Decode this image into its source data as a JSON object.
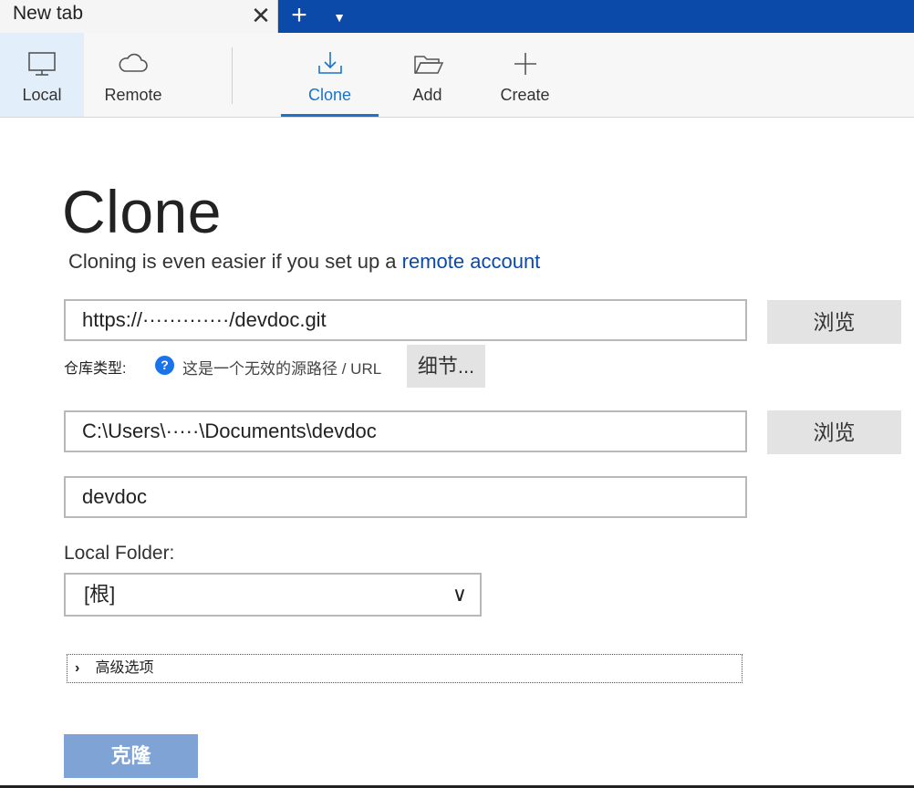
{
  "tabs": {
    "title": "New tab",
    "close_glyph": "✕",
    "add_glyph": "+",
    "dropdown_glyph": "▼"
  },
  "toolbar": {
    "local": {
      "label": "Local",
      "icon": "monitor-icon"
    },
    "remote": {
      "label": "Remote",
      "icon": "cloud-icon"
    },
    "clone": {
      "label": "Clone",
      "icon": "download-icon"
    },
    "add": {
      "label": "Add",
      "icon": "folder-open-icon"
    },
    "create": {
      "label": "Create",
      "icon": "plus-icon"
    }
  },
  "main": {
    "title": "Clone",
    "subtitle_prefix": "Cloning is even easier if you set up a ",
    "subtitle_link": "remote account",
    "source_url": "https://·············/devdoc.git",
    "browse_label": "浏览",
    "repo_type_label": "仓库类型:",
    "help_glyph": "?",
    "repo_status": "这是一个无效的源路径 / URL",
    "details_label": "细节...",
    "dest_path": "C:\\Users\\·····\\Documents\\devdoc",
    "name": "devdoc",
    "local_folder_label": "Local Folder:",
    "local_folder_value": "[根]",
    "chevron_glyph": "∨",
    "advanced_arrow": "›",
    "advanced_label": "高级选项",
    "clone_button": "克隆"
  },
  "colors": {
    "accent": "#1a73c8",
    "tabstrip": "#0b4aa8",
    "clone_button": "#7fa3d5"
  }
}
